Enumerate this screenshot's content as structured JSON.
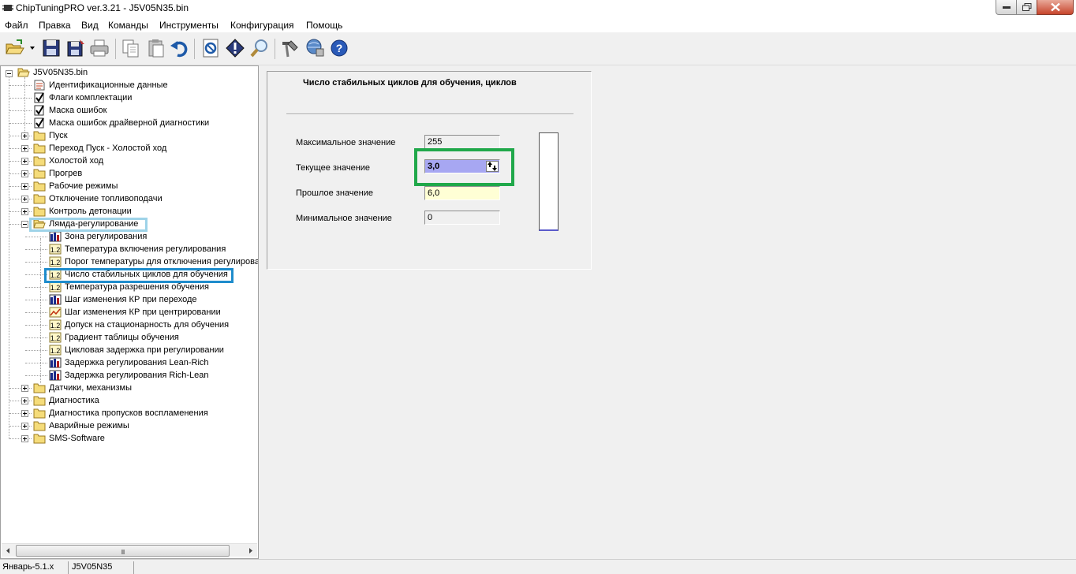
{
  "window": {
    "title": "ChipTuningPRO ver.3.21 - J5V05N35.bin"
  },
  "menu": {
    "items": [
      "Файл",
      "Правка",
      "Вид",
      "Команды",
      "Инструменты",
      "Конфигурация",
      "Помощь"
    ]
  },
  "toolbar": {
    "buttons": [
      "open-icon",
      "save-icon",
      "save-as-icon",
      "print-icon",
      "copy-icon",
      "paste-icon",
      "undo-icon",
      "compare-icon",
      "info-icon",
      "search-icon",
      "tools-icon",
      "connect-icon",
      "help-icon"
    ]
  },
  "tree": {
    "root": "J5V05N35.bin",
    "items": [
      {
        "label": "Идентификационные данные",
        "icon": "document-icon",
        "level": 1
      },
      {
        "label": "Флаги комплектации",
        "icon": "checkbox-icon",
        "level": 1
      },
      {
        "label": "Маска ошибок",
        "icon": "checkbox-icon",
        "level": 1
      },
      {
        "label": "Маска ошибок драйверной диагностики",
        "icon": "checkbox-icon",
        "level": 1
      },
      {
        "label": "Пуск",
        "icon": "folder-icon",
        "level": 1
      },
      {
        "label": "Переход Пуск - Холостой ход",
        "icon": "folder-icon",
        "level": 1
      },
      {
        "label": "Холостой ход",
        "icon": "folder-icon",
        "level": 1
      },
      {
        "label": "Прогрев",
        "icon": "folder-icon",
        "level": 1
      },
      {
        "label": "Рабочие режимы",
        "icon": "folder-icon",
        "level": 1
      },
      {
        "label": "Отключение топливоподачи",
        "icon": "folder-icon",
        "level": 1
      },
      {
        "label": "Контроль детонации",
        "icon": "folder-icon",
        "level": 1
      },
      {
        "label": "Лямда-регулирование",
        "icon": "open-folder-icon",
        "level": 1
      },
      {
        "label": "Зона регулирования",
        "icon": "table-icon",
        "level": 2
      },
      {
        "label": "Температура включения регулирования",
        "icon": "value-icon",
        "level": 2
      },
      {
        "label": "Порог температуры для отключения регулирова",
        "icon": "value-icon",
        "level": 2
      },
      {
        "label": "Число стабильных циклов для обучения",
        "icon": "value-icon",
        "level": 2
      },
      {
        "label": "Температура разрешения обучения",
        "icon": "value-icon",
        "level": 2
      },
      {
        "label": "Шаг изменения КР при переходе",
        "icon": "table-icon",
        "level": 2
      },
      {
        "label": "Шаг изменения КР при центрировании",
        "icon": "graph-icon",
        "level": 2
      },
      {
        "label": "Допуск на стационарность для обучения",
        "icon": "value-icon",
        "level": 2
      },
      {
        "label": "Градиент таблицы обучения",
        "icon": "value-icon",
        "level": 2
      },
      {
        "label": "Цикловая задержка при регулировании",
        "icon": "value-icon",
        "level": 2
      },
      {
        "label": "Задержка регулирования Lean-Rich",
        "icon": "table-icon",
        "level": 2
      },
      {
        "label": "Задержка регулирования Rich-Lean",
        "icon": "table-icon",
        "level": 2
      },
      {
        "label": "Датчики, механизмы",
        "icon": "folder-icon",
        "level": 1
      },
      {
        "label": "Диагностика",
        "icon": "folder-icon",
        "level": 1
      },
      {
        "label": "Диагностика пропусков воспламенения",
        "icon": "folder-icon",
        "level": 1
      },
      {
        "label": "Аварийные режимы",
        "icon": "folder-icon",
        "level": 1
      },
      {
        "label": "SMS-Software",
        "icon": "folder-icon",
        "level": 1
      }
    ]
  },
  "detail": {
    "title": "Число стабильных циклов для обучения, циклов",
    "max_label": "Максимальное значение",
    "max_value": "255",
    "current_label": "Текущее значение",
    "current_value": "3,0",
    "prev_label": "Прошлое значение",
    "prev_value": "6,0",
    "min_label": "Минимальное значение",
    "min_value": "0"
  },
  "scrollbar": {
    "grip": "III"
  },
  "status": {
    "version": "Январь-5.1.x",
    "file": "J5V05N35"
  },
  "colors": {
    "current_field": "#a7a7f2",
    "prev_field": "#ffffd5",
    "highlight_green": "#20a84a",
    "highlight_blue": "#1e8ccc",
    "highlight_light_blue": "#9ed3e8"
  }
}
